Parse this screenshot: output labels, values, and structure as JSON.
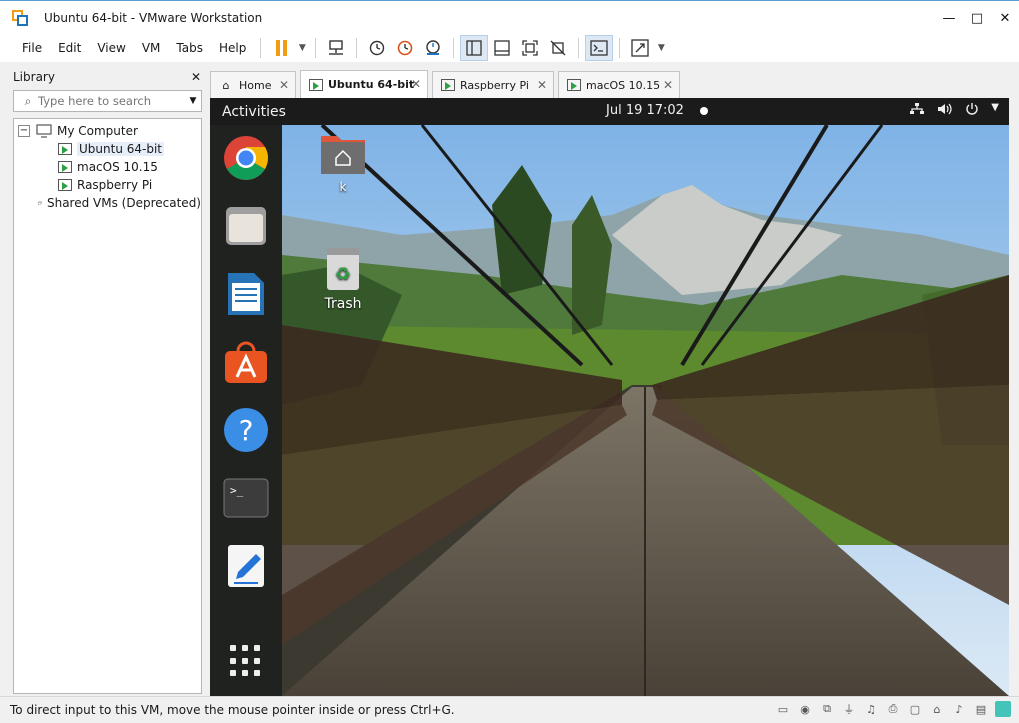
{
  "window": {
    "title": "Ubuntu 64-bit - VMware Workstation"
  },
  "window_controls": {
    "minimize": "—",
    "maximize": "□",
    "close": "✕"
  },
  "menu": {
    "items": [
      "File",
      "Edit",
      "View",
      "VM",
      "Tabs",
      "Help"
    ]
  },
  "library": {
    "title": "Library",
    "close": "✕",
    "search_placeholder": "Type here to search",
    "tree": {
      "root": "My Computer",
      "vms": [
        "Ubuntu 64-bit",
        "macOS 10.15",
        "Raspberry Pi"
      ],
      "shared": "Shared VMs (Deprecated)"
    }
  },
  "tabs": [
    {
      "label": "Home",
      "close": "✕"
    },
    {
      "label": "Ubuntu 64-bit",
      "close": "✕"
    },
    {
      "label": "Raspberry Pi",
      "close": "✕"
    },
    {
      "label": "macOS 10.15",
      "close": "✕"
    }
  ],
  "guest": {
    "activities": "Activities",
    "clock": "Jul 19  17:02",
    "desktop_icons": {
      "home_label": "k",
      "trash_label": "Trash"
    },
    "colors": {
      "panel": "#1b1b1b",
      "ubuntu_orange": "#e95420"
    }
  },
  "statusbar": {
    "message": "To direct input to this VM, move the mouse pointer inside or press Ctrl+G."
  }
}
